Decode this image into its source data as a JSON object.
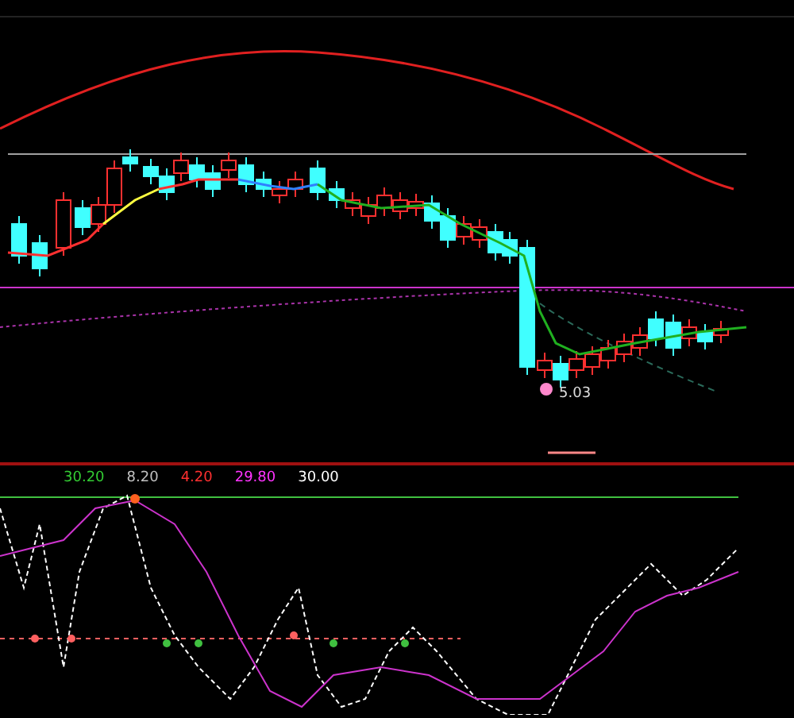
{
  "main_chart": {
    "price_label": "5.03"
  },
  "indicator": {
    "legend": [
      {
        "value": "30.20",
        "color": "#33cc33"
      },
      {
        "value": "8.20",
        "color": "#c0c0c0"
      },
      {
        "value": "4.20",
        "color": "#ff3030"
      },
      {
        "value": "29.80",
        "color": "#ff33ff"
      },
      {
        "value": "30.00",
        "color": "#ffffff"
      }
    ]
  }
}
